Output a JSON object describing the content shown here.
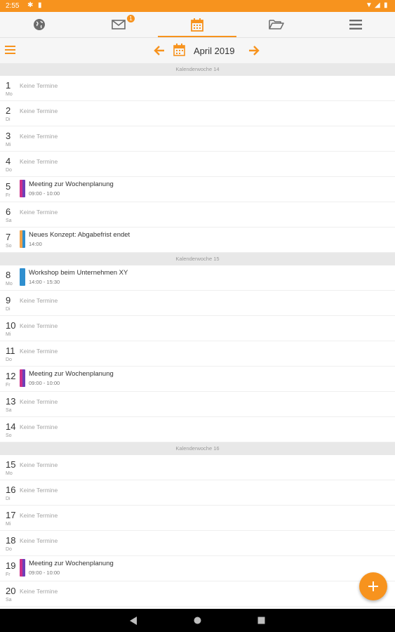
{
  "status": {
    "time": "2:55"
  },
  "tabs": {
    "messages_badge": "1",
    "items": [
      "globe-icon",
      "mail-icon",
      "calendar-icon",
      "folder-open-icon",
      "hamburger-menu-icon"
    ],
    "active": "calendar"
  },
  "header": {
    "month": "April 2019"
  },
  "colors": {
    "accent": "#f7931e"
  },
  "weeks": [
    {
      "label": "Kalenderwoche 14",
      "days": [
        {
          "num": "1",
          "name": "Mo",
          "text": "Keine Termine"
        },
        {
          "num": "2",
          "name": "Di",
          "text": "Keine Termine"
        },
        {
          "num": "3",
          "name": "Mi",
          "text": "Keine Termine"
        },
        {
          "num": "4",
          "name": "Do",
          "text": "Keine Termine"
        },
        {
          "num": "5",
          "name": "Fr",
          "event": {
            "title": "Meeting zur Wochenplanung",
            "time": "09:00 - 10:00",
            "colors": [
              "#cc2f8a",
              "#6f3fb8"
            ]
          }
        },
        {
          "num": "6",
          "name": "Sa",
          "text": "Keine Termine"
        },
        {
          "num": "7",
          "name": "So",
          "event": {
            "title": "Neues Konzept: Abgabefrist endet",
            "time": "14:00",
            "colors": [
              "#f0a24a",
              "#2f8fcf"
            ]
          }
        }
      ]
    },
    {
      "label": "Kalenderwoche 15",
      "days": [
        {
          "num": "8",
          "name": "Mo",
          "event": {
            "title": "Workshop beim Unternehmen XY",
            "time": "14:00 - 15:30",
            "colors": [
              "#2f8fcf"
            ]
          }
        },
        {
          "num": "9",
          "name": "Di",
          "text": "Keine Termine"
        },
        {
          "num": "10",
          "name": "Mi",
          "text": "Keine Termine"
        },
        {
          "num": "11",
          "name": "Do",
          "text": "Keine Termine"
        },
        {
          "num": "12",
          "name": "Fr",
          "event": {
            "title": "Meeting zur Wochenplanung",
            "time": "09:00 - 10:00",
            "colors": [
              "#cc2f8a",
              "#6f3fb8"
            ]
          }
        },
        {
          "num": "13",
          "name": "Sa",
          "text": "Keine Termine"
        },
        {
          "num": "14",
          "name": "So",
          "text": "Keine Termine"
        }
      ]
    },
    {
      "label": "Kalenderwoche 16",
      "days": [
        {
          "num": "15",
          "name": "Mo",
          "text": "Keine Termine"
        },
        {
          "num": "16",
          "name": "Di",
          "text": "Keine Termine"
        },
        {
          "num": "17",
          "name": "Mi",
          "text": "Keine Termine"
        },
        {
          "num": "18",
          "name": "Do",
          "text": "Keine Termine"
        },
        {
          "num": "19",
          "name": "Fr",
          "event": {
            "title": "Meeting zur Wochenplanung",
            "time": "09:00 - 10:00",
            "colors": [
              "#cc2f8a",
              "#6f3fb8"
            ]
          }
        },
        {
          "num": "20",
          "name": "Sa",
          "text": "Keine Termine"
        }
      ]
    }
  ]
}
